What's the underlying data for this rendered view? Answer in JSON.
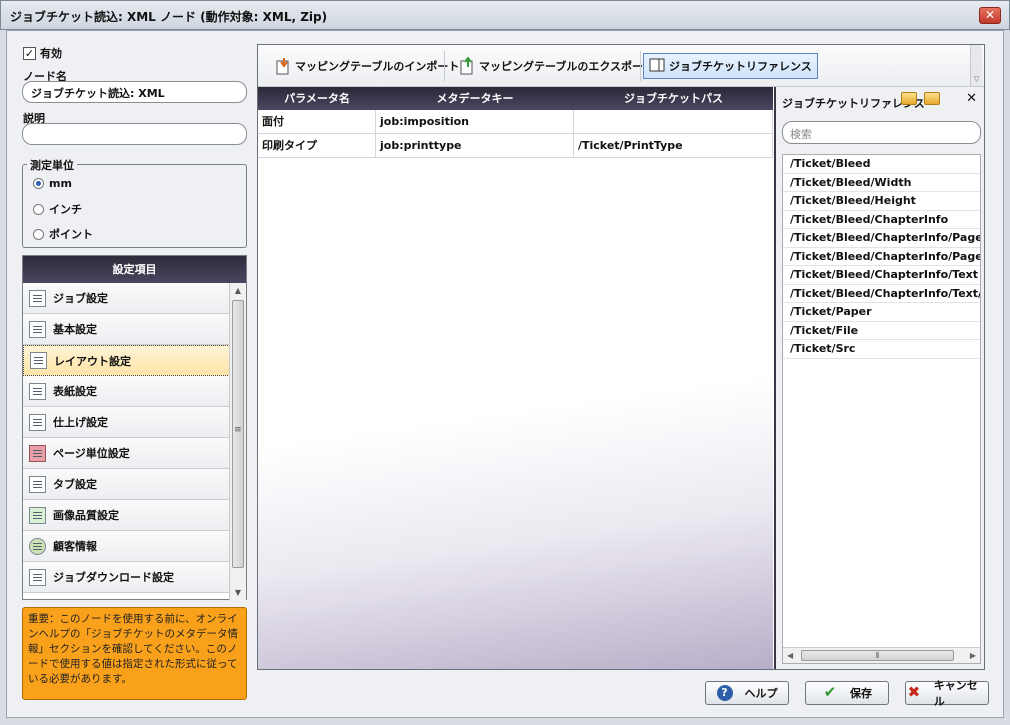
{
  "window": {
    "title": "ジョブチケット読込: XML ノード (動作対象: XML, Zip)",
    "close_glyph": "✕"
  },
  "enabled": {
    "label": "有効",
    "checked": true,
    "check_glyph": "✓"
  },
  "node_name": {
    "label": "ノード名",
    "value": "ジョブチケット読込: XML"
  },
  "description": {
    "label": "説明",
    "value": ""
  },
  "units": {
    "legend": "測定単位",
    "options": [
      {
        "label": "mm",
        "selected": true
      },
      {
        "label": "インチ",
        "selected": false
      },
      {
        "label": "ポイント",
        "selected": false
      }
    ]
  },
  "settings": {
    "header": "設定項目",
    "items": [
      {
        "label": "ジョブ設定",
        "icon": "document-icon"
      },
      {
        "label": "基本設定",
        "icon": "list-icon"
      },
      {
        "label": "レイアウト設定",
        "icon": "layout-icon",
        "selected": true
      },
      {
        "label": "表紙設定",
        "icon": "cover-icon"
      },
      {
        "label": "仕上げ設定",
        "icon": "finishing-icon"
      },
      {
        "label": "ページ単位設定",
        "icon": "page-icon"
      },
      {
        "label": "タブ設定",
        "icon": "tab-icon"
      },
      {
        "label": "画像品質設定",
        "icon": "image-icon"
      },
      {
        "label": "顧客情報",
        "icon": "customer-icon"
      },
      {
        "label": "ジョブダウンロード設定",
        "icon": "download-icon"
      }
    ]
  },
  "notice": "重要：このノードを使用する前に、オンラインヘルプの「ジョブチケットのメタデータ情報」セクションを確認してください。このノードで使用する値は指定された形式に従っている必要があります。",
  "toolbar": {
    "import_label": "マッピングテーブルのインポート",
    "export_label": "マッピングテーブルのエクスポート",
    "reference_label": "ジョブチケットリファレンス"
  },
  "table": {
    "headers": [
      "パラメータ名",
      "メタデータキー",
      "ジョブチケットパス"
    ],
    "rows": [
      [
        "面付",
        "job:imposition",
        ""
      ],
      [
        "印刷タイプ",
        "job:printtype",
        "/Ticket/PrintType"
      ]
    ]
  },
  "reference": {
    "title": "ジョブチケットリファレンス",
    "search_placeholder": "検索",
    "close_glyph": "✕",
    "items": [
      "/Ticket/Bleed",
      "/Ticket/Bleed/Width",
      "/Ticket/Bleed/Height",
      "/Ticket/Bleed/ChapterInfo",
      "/Ticket/Bleed/ChapterInfo/Page",
      "/Ticket/Bleed/ChapterInfo/Page/Cha",
      "/Ticket/Bleed/ChapterInfo/Text",
      "/Ticket/Bleed/ChapterInfo/Text/Chap",
      "/Ticket/Paper",
      "/Ticket/File",
      "/Ticket/Src"
    ]
  },
  "buttons": {
    "help": "ヘルプ",
    "save": "保存",
    "cancel": "キャンセル"
  },
  "colors": {
    "notice": "#f9a11b",
    "header_dark": "#2e2a3a",
    "selection": "#fde3a6"
  }
}
